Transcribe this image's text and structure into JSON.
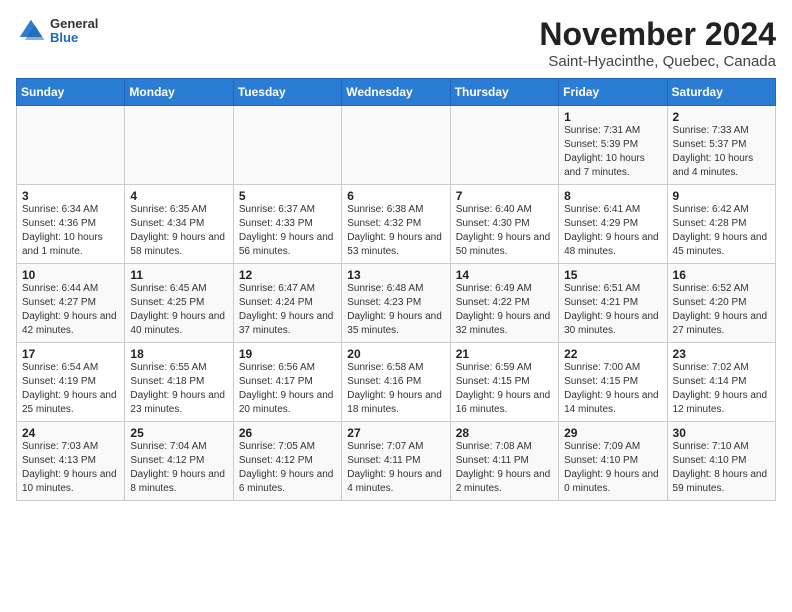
{
  "header": {
    "logo": {
      "general": "General",
      "blue": "Blue"
    },
    "title": "November 2024",
    "subtitle": "Saint-Hyacinthe, Quebec, Canada"
  },
  "weekdays": [
    "Sunday",
    "Monday",
    "Tuesday",
    "Wednesday",
    "Thursday",
    "Friday",
    "Saturday"
  ],
  "weeks": [
    [
      {
        "day": "",
        "detail": ""
      },
      {
        "day": "",
        "detail": ""
      },
      {
        "day": "",
        "detail": ""
      },
      {
        "day": "",
        "detail": ""
      },
      {
        "day": "",
        "detail": ""
      },
      {
        "day": "1",
        "detail": "Sunrise: 7:31 AM\nSunset: 5:39 PM\nDaylight: 10 hours and 7 minutes."
      },
      {
        "day": "2",
        "detail": "Sunrise: 7:33 AM\nSunset: 5:37 PM\nDaylight: 10 hours and 4 minutes."
      }
    ],
    [
      {
        "day": "3",
        "detail": "Sunrise: 6:34 AM\nSunset: 4:36 PM\nDaylight: 10 hours and 1 minute."
      },
      {
        "day": "4",
        "detail": "Sunrise: 6:35 AM\nSunset: 4:34 PM\nDaylight: 9 hours and 58 minutes."
      },
      {
        "day": "5",
        "detail": "Sunrise: 6:37 AM\nSunset: 4:33 PM\nDaylight: 9 hours and 56 minutes."
      },
      {
        "day": "6",
        "detail": "Sunrise: 6:38 AM\nSunset: 4:32 PM\nDaylight: 9 hours and 53 minutes."
      },
      {
        "day": "7",
        "detail": "Sunrise: 6:40 AM\nSunset: 4:30 PM\nDaylight: 9 hours and 50 minutes."
      },
      {
        "day": "8",
        "detail": "Sunrise: 6:41 AM\nSunset: 4:29 PM\nDaylight: 9 hours and 48 minutes."
      },
      {
        "day": "9",
        "detail": "Sunrise: 6:42 AM\nSunset: 4:28 PM\nDaylight: 9 hours and 45 minutes."
      }
    ],
    [
      {
        "day": "10",
        "detail": "Sunrise: 6:44 AM\nSunset: 4:27 PM\nDaylight: 9 hours and 42 minutes."
      },
      {
        "day": "11",
        "detail": "Sunrise: 6:45 AM\nSunset: 4:25 PM\nDaylight: 9 hours and 40 minutes."
      },
      {
        "day": "12",
        "detail": "Sunrise: 6:47 AM\nSunset: 4:24 PM\nDaylight: 9 hours and 37 minutes."
      },
      {
        "day": "13",
        "detail": "Sunrise: 6:48 AM\nSunset: 4:23 PM\nDaylight: 9 hours and 35 minutes."
      },
      {
        "day": "14",
        "detail": "Sunrise: 6:49 AM\nSunset: 4:22 PM\nDaylight: 9 hours and 32 minutes."
      },
      {
        "day": "15",
        "detail": "Sunrise: 6:51 AM\nSunset: 4:21 PM\nDaylight: 9 hours and 30 minutes."
      },
      {
        "day": "16",
        "detail": "Sunrise: 6:52 AM\nSunset: 4:20 PM\nDaylight: 9 hours and 27 minutes."
      }
    ],
    [
      {
        "day": "17",
        "detail": "Sunrise: 6:54 AM\nSunset: 4:19 PM\nDaylight: 9 hours and 25 minutes."
      },
      {
        "day": "18",
        "detail": "Sunrise: 6:55 AM\nSunset: 4:18 PM\nDaylight: 9 hours and 23 minutes."
      },
      {
        "day": "19",
        "detail": "Sunrise: 6:56 AM\nSunset: 4:17 PM\nDaylight: 9 hours and 20 minutes."
      },
      {
        "day": "20",
        "detail": "Sunrise: 6:58 AM\nSunset: 4:16 PM\nDaylight: 9 hours and 18 minutes."
      },
      {
        "day": "21",
        "detail": "Sunrise: 6:59 AM\nSunset: 4:15 PM\nDaylight: 9 hours and 16 minutes."
      },
      {
        "day": "22",
        "detail": "Sunrise: 7:00 AM\nSunset: 4:15 PM\nDaylight: 9 hours and 14 minutes."
      },
      {
        "day": "23",
        "detail": "Sunrise: 7:02 AM\nSunset: 4:14 PM\nDaylight: 9 hours and 12 minutes."
      }
    ],
    [
      {
        "day": "24",
        "detail": "Sunrise: 7:03 AM\nSunset: 4:13 PM\nDaylight: 9 hours and 10 minutes."
      },
      {
        "day": "25",
        "detail": "Sunrise: 7:04 AM\nSunset: 4:12 PM\nDaylight: 9 hours and 8 minutes."
      },
      {
        "day": "26",
        "detail": "Sunrise: 7:05 AM\nSunset: 4:12 PM\nDaylight: 9 hours and 6 minutes."
      },
      {
        "day": "27",
        "detail": "Sunrise: 7:07 AM\nSunset: 4:11 PM\nDaylight: 9 hours and 4 minutes."
      },
      {
        "day": "28",
        "detail": "Sunrise: 7:08 AM\nSunset: 4:11 PM\nDaylight: 9 hours and 2 minutes."
      },
      {
        "day": "29",
        "detail": "Sunrise: 7:09 AM\nSunset: 4:10 PM\nDaylight: 9 hours and 0 minutes."
      },
      {
        "day": "30",
        "detail": "Sunrise: 7:10 AM\nSunset: 4:10 PM\nDaylight: 8 hours and 59 minutes."
      }
    ]
  ]
}
